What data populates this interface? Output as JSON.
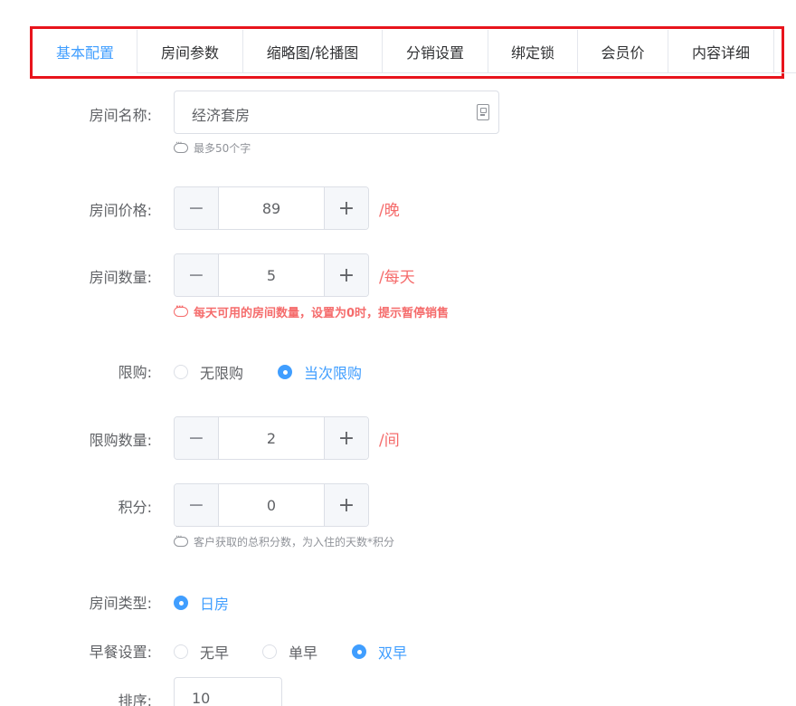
{
  "tabs": [
    {
      "label": "基本配置",
      "active": true
    },
    {
      "label": "房间参数"
    },
    {
      "label": "缩略图/轮播图"
    },
    {
      "label": "分销设置"
    },
    {
      "label": "绑定锁"
    },
    {
      "label": "会员价"
    },
    {
      "label": "内容详细"
    }
  ],
  "room_name": {
    "label": "房间名称:",
    "value": "经济套房",
    "hint": "最多50个字"
  },
  "room_price": {
    "label": "房间价格:",
    "value": "89",
    "unit": "/晚"
  },
  "room_count": {
    "label": "房间数量:",
    "value": "5",
    "unit": "/每天",
    "hint": "每天可用的房间数量，设置为0时，提示暂停销售"
  },
  "purchase_limit": {
    "label": "限购:",
    "options": [
      "无限购",
      "当次限购"
    ],
    "selected": "当次限购"
  },
  "limit_count": {
    "label": "限购数量:",
    "value": "2",
    "unit": "/间"
  },
  "points": {
    "label": "积分:",
    "value": "0",
    "hint": "客户获取的总积分数，为入住的天数*积分"
  },
  "room_type": {
    "label": "房间类型:",
    "options": [
      "日房"
    ],
    "selected": "日房"
  },
  "breakfast": {
    "label": "早餐设置:",
    "options": [
      "无早",
      "单早",
      "双早"
    ],
    "selected": "双早"
  },
  "sort": {
    "label": "排序:",
    "value": "10"
  },
  "colors": {
    "accent": "#409eff",
    "error": "#f56c6c",
    "highlight_border": "#e8141c"
  },
  "icons": {
    "minus": "minus-icon",
    "plus": "plus-icon",
    "hint": "info-bubble-icon",
    "counter": "text-counter-icon"
  }
}
